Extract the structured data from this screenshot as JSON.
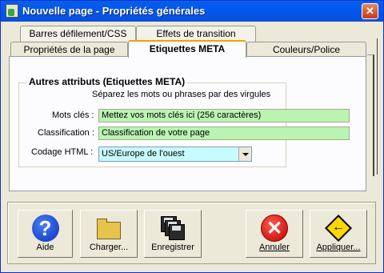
{
  "window": {
    "title": "Nouvelle page - Propriétés générales",
    "close_glyph": "✕"
  },
  "tabs": {
    "row_back": [
      "Barres défilement/CSS",
      "Effets de transition"
    ],
    "row_front": [
      "Propriétés de la page",
      "Etiquettes META",
      "Couleurs/Police"
    ],
    "active": "Etiquettes META"
  },
  "meta": {
    "group_title": "Autres attributs (Etiquettes META)",
    "hint": "Séparez les mots ou phrases par des virgules",
    "keywords": {
      "label": "Mots clés :",
      "value": "Mettez vos mots clés ici (256 caractères)"
    },
    "classification": {
      "label": "Classification :",
      "value": "Classification de votre page"
    },
    "encoding": {
      "label": "Codage HTML :",
      "value": "US/Europe de l'ouest"
    }
  },
  "buttons": {
    "help": "Aide",
    "load": "Charger...",
    "save": "Enregistrer",
    "cancel": "Annuler",
    "apply": "Appliquer..."
  },
  "icons": {
    "help": "help-question-icon",
    "load": "folder-icon",
    "save": "floppy-disks-icon",
    "cancel": "cancel-x-icon",
    "apply": "apply-arrow-icon"
  },
  "colors": {
    "titlebar": "#0058ee",
    "field_green": "#b9f5b1",
    "select_cyan": "#c6fbff"
  }
}
